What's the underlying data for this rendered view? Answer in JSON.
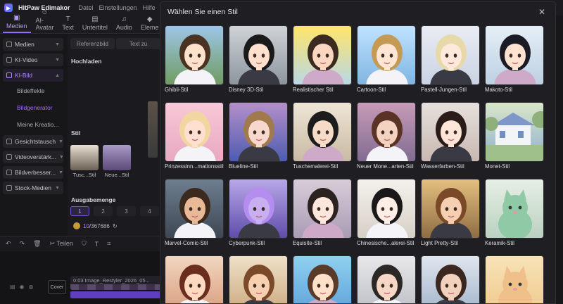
{
  "titlebar": {
    "app_title": "HitPaw Edimakor",
    "menus": [
      "Datei",
      "Einstellungen",
      "Hilfe"
    ]
  },
  "toolbar": {
    "tabs": [
      {
        "label": "Medien",
        "icon": "media-icon"
      },
      {
        "label": "AI-Avatar",
        "icon": "avatar-icon"
      },
      {
        "label": "Text",
        "icon": "text-icon"
      },
      {
        "label": "Untertitel",
        "icon": "subtitle-icon"
      },
      {
        "label": "Audio",
        "icon": "audio-icon"
      },
      {
        "label": "Eleme",
        "icon": "elements-icon"
      }
    ]
  },
  "sidebar": {
    "medien": "Medien",
    "ki_video": "KI-Video",
    "ki_bild": "KI-Bild",
    "bildeffekte": "Bildeffekte",
    "bildgenerator": "Bildgenerator",
    "meine": "Meine Kreatio...",
    "gesichtstausch": "Gesichtstausch",
    "videoverstark": "Videoverstärk...",
    "bildverbesser": "Bildverbesser...",
    "stock": "Stock-Medien"
  },
  "panel": {
    "seg_ref": "Referenzbild",
    "seg_text": "Text zu",
    "hochladen": "Hochladen",
    "stil": "Stil",
    "style_items": [
      "Tusc...Stil",
      "Neue...Stil"
    ],
    "ausgabemenge": "Ausgabemenge",
    "quantities": [
      "1",
      "2",
      "3",
      "4"
    ],
    "credits_used": "10",
    "credits_total": "/367686"
  },
  "editbar": {
    "teilen": "Teilen"
  },
  "timeline": {
    "cover": "Cover",
    "clip_label": "0:03 Image_Restyler_2026_05..."
  },
  "modal": {
    "title": "Wählen Sie einen Stil",
    "close_icon": "close-icon",
    "styles": [
      "Ghibli-Stil",
      "Disney 3D-Stil",
      "Realistischer Stil",
      "Cartoon-Stil",
      "Pastell-Jungen-Stil",
      "Makoto-Stil",
      "Prinzessinn...mationsstil",
      "Blueline-Stil",
      "Tuschemalerei-Stil",
      "Neuer Mone...arten-Stil",
      "Wasserfarben-Stil",
      "Monet-Stil",
      "Marvel-Comic-Stil",
      "Cyberpunk-Stil",
      "Equisite-Stil",
      "Chinesische...alerei-Stil",
      "Light Pretty-Stil",
      "Keramik-Stil",
      "",
      "",
      "",
      "",
      "",
      ""
    ]
  }
}
